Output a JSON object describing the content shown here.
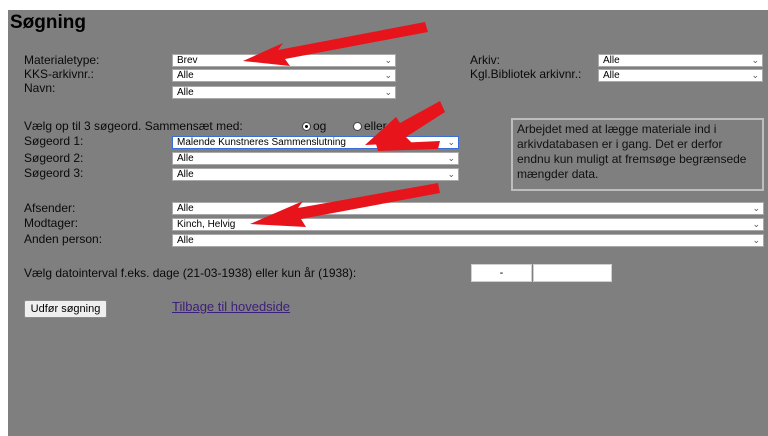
{
  "page_title": "Søgning",
  "fields": {
    "materialetype": {
      "label": "Materialetype:",
      "value": "Brev"
    },
    "kks": {
      "label": "KKS-arkivnr.:",
      "value": "Alle"
    },
    "navn": {
      "label": "Navn:",
      "value": "Alle"
    },
    "arkiv": {
      "label": "Arkiv:",
      "value": "Alle"
    },
    "kgl": {
      "label": "Kgl.Bibliotek arkivnr.:",
      "value": "Alle"
    }
  },
  "search": {
    "intro": "Vælg op til 3 søgeord. Sammensæt med:",
    "radio_og": "og",
    "radio_eller": "eller",
    "term1": {
      "label": "Søgeord 1:",
      "value": "Malende Kunstneres Sammenslutning"
    },
    "term2": {
      "label": "Søgeord 2:",
      "value": "Alle"
    },
    "term3": {
      "label": "Søgeord 3:",
      "value": "Alle"
    }
  },
  "notice": "Arbejdet med at lægge materiale ind i arkivdatabasen er i gang. Det er derfor endnu kun muligt at fremsøge begrænsede mængder data.",
  "persons": {
    "afsender": {
      "label": "Afsender:",
      "value": "Alle"
    },
    "modtager": {
      "label": "Modtager:",
      "value": "Kinch, Helvig"
    },
    "anden": {
      "label": "Anden person:",
      "value": "Alle"
    }
  },
  "date": {
    "label": "Vælg datointerval f.eks. dage (21-03-1938) eller kun år (1938):",
    "separator": "-"
  },
  "actions": {
    "submit": "Udfør søgning",
    "back_link": "Tilbage til hovedside"
  },
  "colors": {
    "panel_bg": "#7f7f7f",
    "arrow": "#e8141b"
  }
}
